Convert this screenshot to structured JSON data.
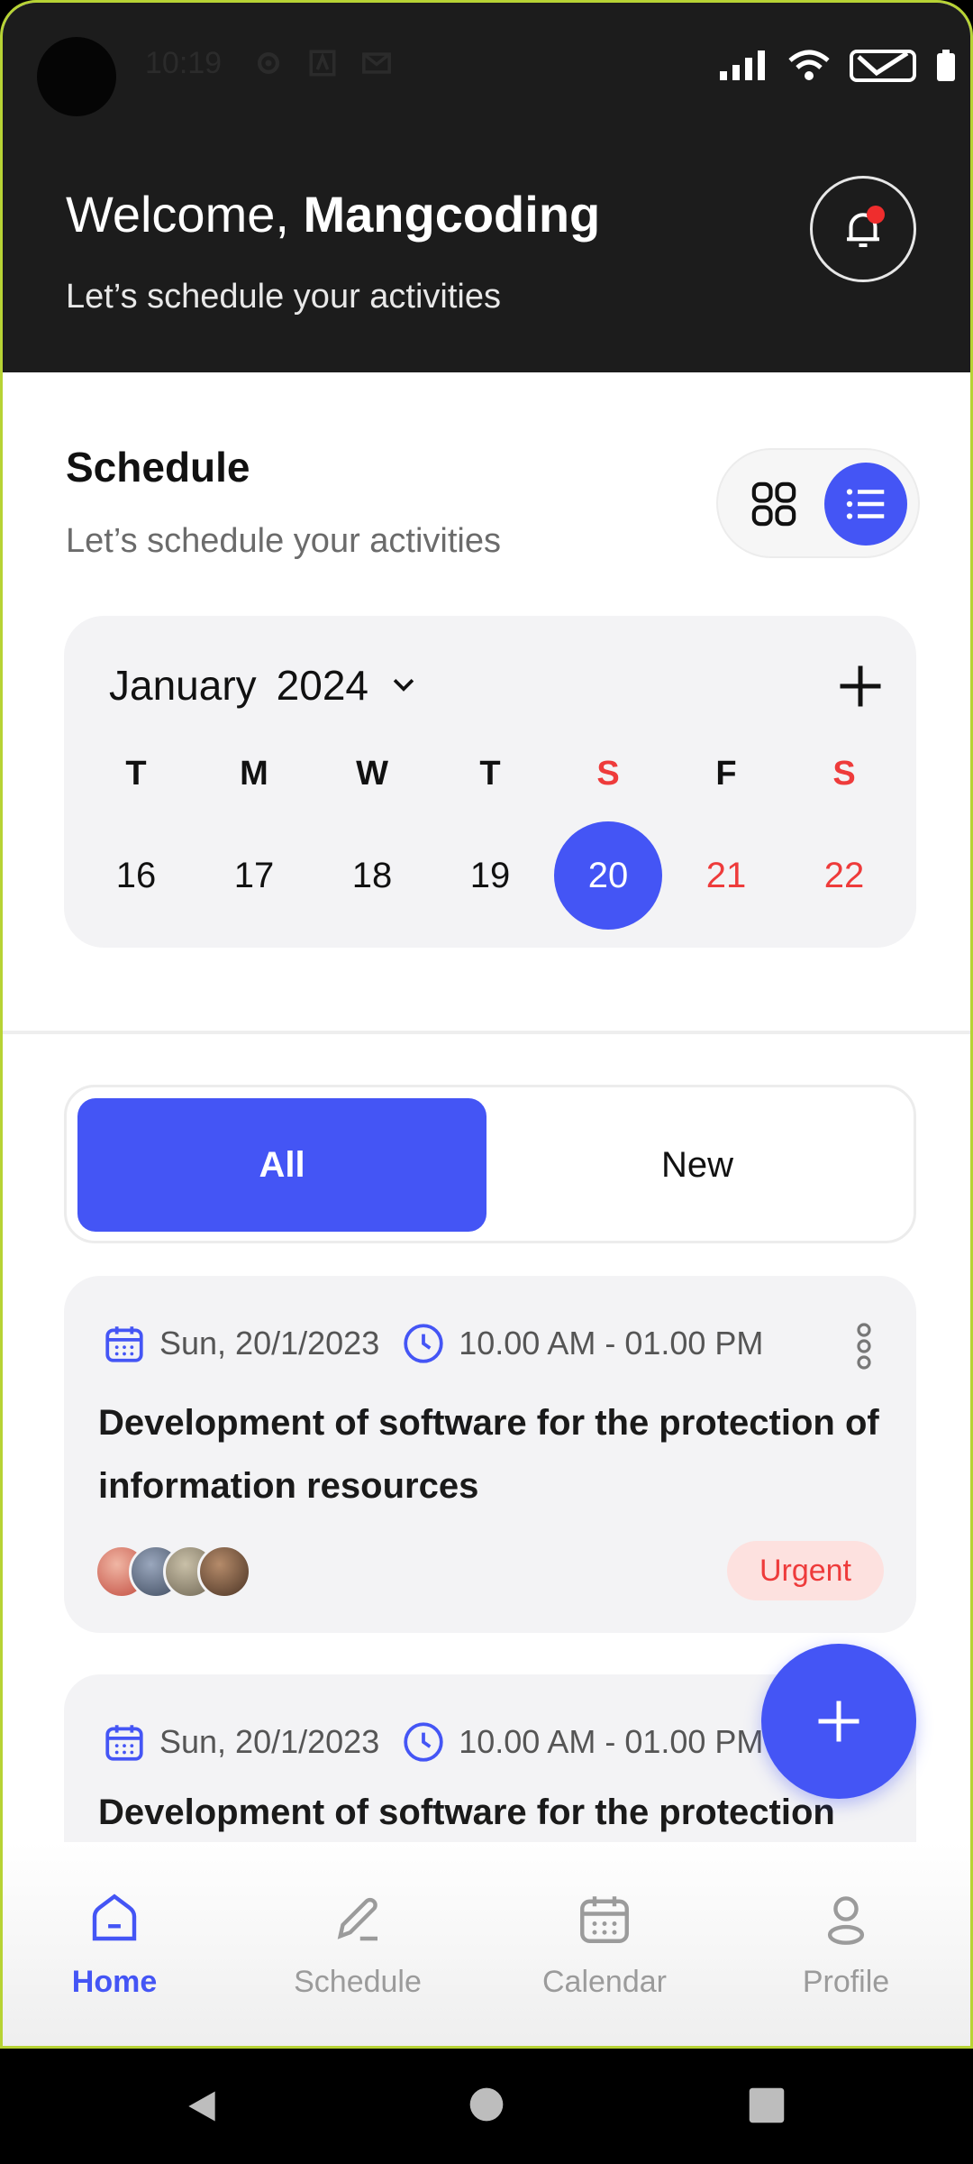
{
  "status_bar": {
    "time": "10:19"
  },
  "header": {
    "greeting": "Welcome,",
    "user_name": "Mangcoding",
    "subtitle": "Let’s schedule your activities"
  },
  "schedule": {
    "title": "Schedule",
    "subtitle": "Let’s schedule your activities"
  },
  "calendar": {
    "month": "January",
    "year": "2024",
    "days": [
      {
        "letter": "T",
        "num": "16",
        "weekend": false
      },
      {
        "letter": "M",
        "num": "17",
        "weekend": false
      },
      {
        "letter": "W",
        "num": "18",
        "weekend": false
      },
      {
        "letter": "T",
        "num": "19",
        "weekend": false
      },
      {
        "letter": "S",
        "num": "20",
        "weekend": true,
        "selected": true
      },
      {
        "letter": "F",
        "num": "21",
        "weekend": false,
        "red_num": true
      },
      {
        "letter": "S",
        "num": "22",
        "weekend": true
      }
    ]
  },
  "tabs": {
    "all": "All",
    "new": "New"
  },
  "events": [
    {
      "date": "Sun, 20/1/2023",
      "time": "10.00 AM - 01.00 PM",
      "title": "Development of software for the protection of information resources",
      "priority": "Urgent"
    },
    {
      "date": "Sun, 20/1/2023",
      "time": "10.00 AM - 01.00 PM",
      "title": "Development of software for the protection"
    }
  ],
  "nav": {
    "home": "Home",
    "schedule": "Schedule",
    "calendar": "Calendar",
    "profile": "Profile"
  },
  "colors": {
    "accent": "#4455f5",
    "weekend": "#ee3b3b",
    "header_bg": "#1c1c1c",
    "urgent_bg": "#fde1df"
  }
}
